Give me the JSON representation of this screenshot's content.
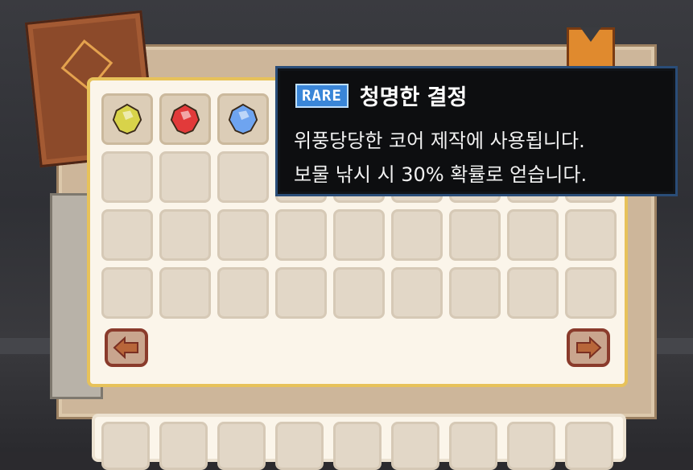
{
  "tooltip": {
    "rarity": "RARE",
    "title": "청명한 결정",
    "description": [
      "위풍당당한 코어 제작에 사용됩니다.",
      "보물 낚시 시 30% 확률로 얻습니다."
    ],
    "rarity_color": "#3a86d8"
  },
  "inventory": {
    "rows": 4,
    "cols": 9,
    "items": [
      {
        "slot": 0,
        "icon": "yellow-crystal-icon",
        "color": "#d8d34a"
      },
      {
        "slot": 1,
        "icon": "red-crystal-icon",
        "color": "#e23a3a"
      },
      {
        "slot": 2,
        "icon": "blue-crystal-icon",
        "color": "#6ea4f0"
      }
    ]
  },
  "nav": {
    "prev_icon": "arrow-left-icon",
    "next_icon": "arrow-right-icon"
  },
  "colors": {
    "panel_border": "#e7c25a",
    "arrow_border": "#8a3b2c"
  }
}
